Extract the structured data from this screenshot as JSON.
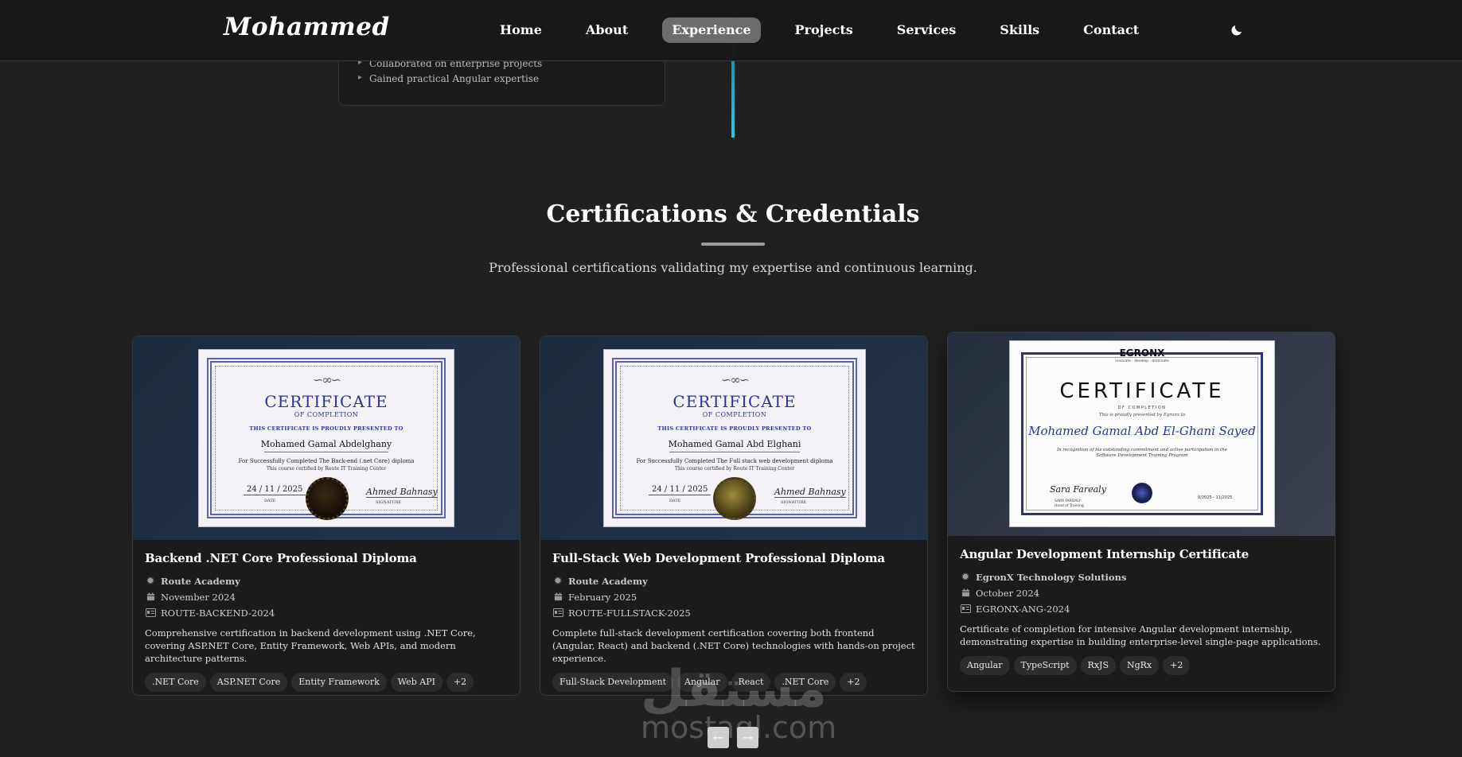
{
  "nav": {
    "logo": "Mohammed",
    "links": [
      "Home",
      "About",
      "Experience",
      "Projects",
      "Services",
      "Skills",
      "Contact"
    ],
    "active": "Experience",
    "theme_icon": "moon-icon"
  },
  "experience": {
    "bullets": [
      "Collaborated on enterprise projects",
      "Gained practical Angular expertise"
    ]
  },
  "section": {
    "title": "Certifications & Credentials",
    "subtitle": "Professional certifications validating my expertise and continuous learning."
  },
  "certificates": [
    {
      "title": "Backend .NET Core Professional Diploma",
      "issuer": "Route Academy",
      "date": "November 2024",
      "id": "ROUTE-BACKEND-2024",
      "description": "Comprehensive certification in backend development using .NET Core, covering ASP.NET Core, Entity Framework, Web APIs, and modern architecture patterns.",
      "tags": [
        ".NET Core",
        "ASP.NET Core",
        "Entity Framework",
        "Web API",
        "+2"
      ],
      "image": {
        "title": "CERTIFICATE",
        "sub": "OF COMPLETION",
        "presented": "THIS CERTIFICATE IS PROUDLY PRESENTED TO",
        "name": "Mohamed Gamal Abdelghany",
        "completed": "For Successfully Completed The  Back-end (.net Core) diploma",
        "certified": "This course certified by Route IT Training Center",
        "date": "24 / 11 / 2025",
        "date_label": "DATE",
        "signature": "Ahmed Bahnasy",
        "signature_label": "SIGNATURE"
      }
    },
    {
      "title": "Full-Stack Web Development Professional Diploma",
      "issuer": "Route Academy",
      "date": "February 2025",
      "id": "ROUTE-FULLSTACK-2025",
      "description": "Complete full-stack development certification covering both frontend (Angular, React) and backend (.NET Core) technologies with hands-on project experience.",
      "tags": [
        "Full-Stack Development",
        "Angular",
        "React",
        ".NET Core",
        "+2"
      ],
      "image": {
        "title": "CERTIFICATE",
        "sub": "OF COMPLETION",
        "presented": "THIS CERTIFICATE IS PROUDLY PRESENTED TO",
        "name": "Mohamed Gamal Abd Elghani",
        "completed": "For Successfully Completed The  Full stack web development diploma",
        "certified": "This course certified by Route IT Training Center",
        "date": "24 / 11 / 2025",
        "date_label": "DATE",
        "signature": "Ahmed Bahnasy",
        "signature_label": "SIGNATURE"
      }
    },
    {
      "title": "Angular Development Internship Certificate",
      "issuer": "EgronX Technology Solutions",
      "date": "October 2024",
      "id": "EGRONX-ANG-2024",
      "description": "Certificate of completion for intensive Angular development internship, demonstrating expertise in building enterprise-level single-page applications.",
      "tags": [
        "Angular",
        "TypeScript",
        "RxJS",
        "NgRx",
        "+2"
      ],
      "image": {
        "logo": "EGRONX",
        "tagline": "innovate · develop · dominate",
        "title": "CERTIFICATE",
        "sub": "OF COMPLETION",
        "presented": "This is proudly presented by Egronx to",
        "name": "Mohamed Gamal Abd El-Ghani Sayed",
        "recognition": "In recognition of his outstanding commitment and active participation in the Software Development Training Program",
        "signature": "Sara Farealy",
        "signature_name": "SARA FARGALY",
        "signature_role": "Head of Training",
        "date": "8/2025 - 11/2025"
      }
    }
  ],
  "carousel": {
    "prev_icon": "arrow-left-icon",
    "next_icon": "arrow-right-icon",
    "prev": "←",
    "next": "→"
  },
  "watermark": {
    "arabic": "مستقل",
    "latin": "mostaql.com"
  },
  "colors": {
    "accent_timeline": "#28c8f0",
    "card_bg": "#1b1b1b",
    "tag_bg": "#2c2c2c"
  }
}
